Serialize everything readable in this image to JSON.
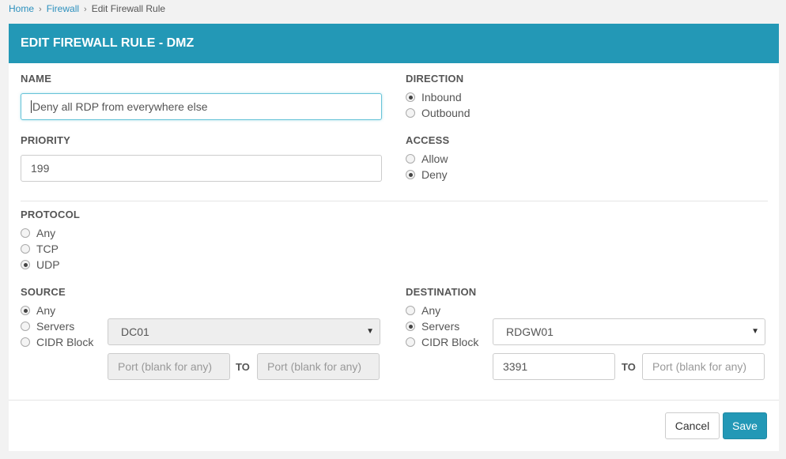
{
  "breadcrumb": {
    "home": "Home",
    "firewall": "Firewall",
    "current": "Edit Firewall Rule",
    "separator": "›"
  },
  "panel": {
    "title": "EDIT FIREWALL RULE - DMZ"
  },
  "name": {
    "label": "NAME",
    "value": "Deny all RDP from everywhere else"
  },
  "priority": {
    "label": "PRIORITY",
    "value": "199"
  },
  "direction": {
    "label": "DIRECTION",
    "options": [
      "Inbound",
      "Outbound"
    ],
    "selected": "Inbound"
  },
  "access": {
    "label": "ACCESS",
    "options": [
      "Allow",
      "Deny"
    ],
    "selected": "Deny"
  },
  "protocol": {
    "label": "PROTOCOL",
    "options": [
      "Any",
      "TCP",
      "UDP"
    ],
    "selected": "UDP"
  },
  "source": {
    "label": "SOURCE",
    "options": [
      "Any",
      "Servers",
      "CIDR Block"
    ],
    "selected": "Any",
    "server_select": "DC01",
    "port_from_placeholder": "Port (blank for any)",
    "to_label": "TO",
    "port_to_placeholder": "Port (blank for any)"
  },
  "destination": {
    "label": "DESTINATION",
    "options": [
      "Any",
      "Servers",
      "CIDR Block"
    ],
    "selected": "Servers",
    "server_select": "RDGW01",
    "port_from_value": "3391",
    "to_label": "TO",
    "port_to_placeholder": "Port (blank for any)"
  },
  "actions": {
    "cancel": "Cancel",
    "save": "Save"
  },
  "colors": {
    "accent": "#2398b6",
    "link": "#2a8fbd"
  }
}
